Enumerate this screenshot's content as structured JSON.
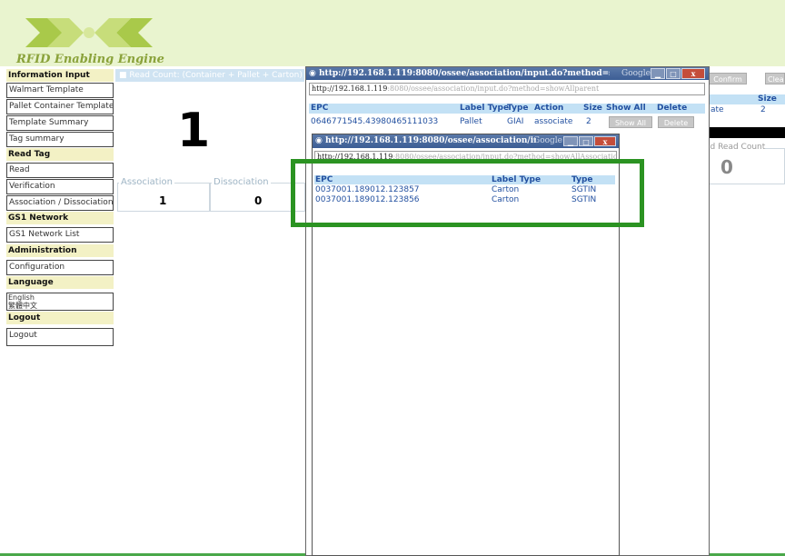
{
  "header": {
    "logo_caption": "RFID Enabling Engine"
  },
  "sidebar": {
    "sections": [
      {
        "title": "Information Input",
        "items": [
          "Walmart Template",
          "Pallet Container Template",
          "Template Summary",
          "Tag summary"
        ]
      },
      {
        "title": "Read Tag",
        "items": [
          "Read",
          "Verification",
          "Association / Dissociation"
        ]
      },
      {
        "title": "GS1 Network",
        "items": [
          "GS1 Network List"
        ]
      },
      {
        "title": "Administration",
        "items": [
          "Configuration"
        ]
      },
      {
        "title": "Language",
        "items": [
          "English",
          "繁體中文"
        ]
      },
      {
        "title": "Logout",
        "items": [
          "Logout"
        ]
      }
    ]
  },
  "main": {
    "read_count_label": "Read Count: (Container + Pallet + Carton)",
    "read_count_value": "1",
    "association_label": "Association",
    "association_value": "1",
    "dissociation_label": "Dissociation",
    "dissociation_value": "0"
  },
  "right_panel": {
    "confirm_all": "Confirm All",
    "clear": "Clea",
    "size_header": "Size",
    "row_action": "ate",
    "row_size": "2",
    "invalid_label": "id Read Count",
    "invalid_value": "0"
  },
  "popup_parent": {
    "title": "http://192.168.1.119:8080/ossee/association/input.do?method=showAllparent - Go...",
    "google": "Google",
    "address_host": "http://192.168.1.119",
    "address_path": ":8080/ossee/association/input.do?method=showAllparent",
    "headers": [
      "EPC",
      "Label Type",
      "Type",
      "Action",
      "Size",
      "Show All",
      "Delete"
    ],
    "row": {
      "epc": "0646771545.43980465111033",
      "label_type": "Pallet",
      "type": "GIAI",
      "action": "associate",
      "size": "2",
      "show_all": "Show All",
      "delete": "Delete"
    }
  },
  "popup_children": {
    "title": "http://192.168.1.119:8080/ossee/association/input.do?m...",
    "google": "Google",
    "address_host": "http://192.168.1.119",
    "address_path": ":8080/ossee/association/input.do?method=showAllAssociation&rfid=34BF269CE15",
    "headers": [
      "EPC",
      "Label Type",
      "Type"
    ],
    "rows": [
      {
        "epc": "0037001.189012.123857",
        "label_type": "Carton",
        "type": "SGTIN"
      },
      {
        "epc": "0037001.189012.123856",
        "label_type": "Carton",
        "type": "SGTIN"
      }
    ]
  },
  "colors": {
    "header_bg": "#e9f4cf",
    "section_bg": "#f3f1c5",
    "table_header_bg": "#c3e1f5",
    "highlight": "#2b9322",
    "link_blue": "#2250a0"
  }
}
